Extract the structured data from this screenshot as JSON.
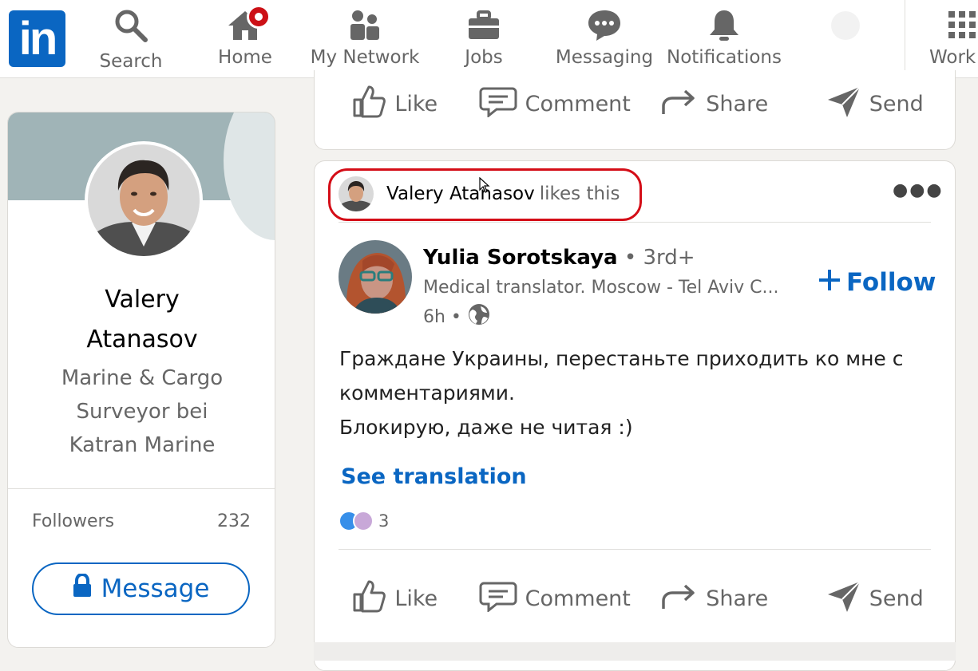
{
  "nav": {
    "logo": "in",
    "items": [
      {
        "label": "Search",
        "icon": "search-icon"
      },
      {
        "label": "Home",
        "icon": "home-icon"
      },
      {
        "label": "My Network",
        "icon": "network-icon"
      },
      {
        "label": "Jobs",
        "icon": "briefcase-icon"
      },
      {
        "label": "Messaging",
        "icon": "chat-icon"
      },
      {
        "label": "Notifications",
        "icon": "bell-icon"
      },
      {
        "label": "Work",
        "icon": "grid-icon"
      }
    ]
  },
  "profile": {
    "name_line1": "Valery",
    "name_line2": "Atanasov",
    "headline_line1": "Marine & Cargo",
    "headline_line2": "Surveyor bei",
    "headline_line3": "Katran Marine",
    "followers_label": "Followers",
    "followers_count": "232",
    "message_label": "Message"
  },
  "actions": {
    "like": "Like",
    "comment": "Comment",
    "share": "Share",
    "send": "Send"
  },
  "post": {
    "liker_name": "Valery Atanasov",
    "liker_suffix": "likes this",
    "author_name": "Yulia Sorotskaya",
    "author_degree": " • 3rd+",
    "author_headline": "Medical translator. Moscow - Tel Aviv C...",
    "time": "6h •",
    "follow_label": "Follow",
    "text_line1": "Граждане Украины, перестаньте приходить ко мне с",
    "text_line2": "комментариями.",
    "text_line3": "Блокирую, даже не читая :)",
    "see_translation": "See translation",
    "reaction_count": "3"
  },
  "colors": {
    "brand": "#0a66c2",
    "highlight": "#d40d17",
    "notification_badge": "#cc1016"
  }
}
